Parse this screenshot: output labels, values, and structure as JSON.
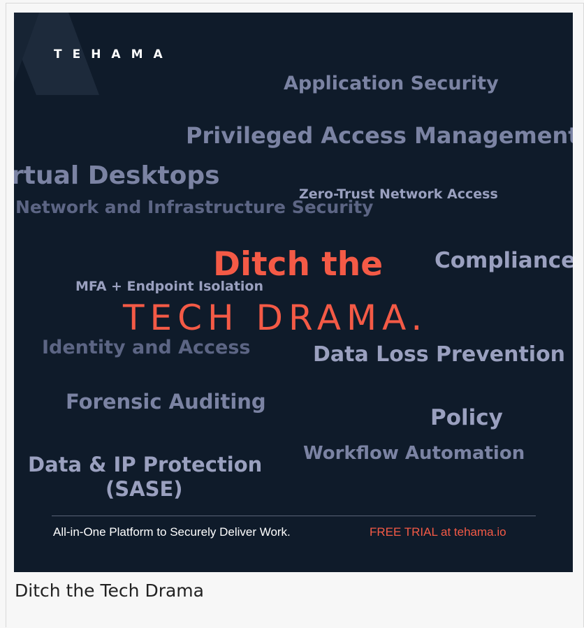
{
  "brand": {
    "logo": "TEHAMA"
  },
  "keywords": {
    "application_security": "Application Security",
    "privileged_access": "Privileged Access Management",
    "virtual_desktops": "rtual Desktops",
    "zero_trust": "Zero-Trust Network Access",
    "network_infra": "Network and Infrastructure Security",
    "compliance": "Compliance",
    "mfa": "MFA + Endpoint Isolation",
    "identity_access": "Identity and Access",
    "data_loss": "Data Loss Prevention",
    "forensic": "Forensic Auditing",
    "policy": "Policy",
    "workflow": "Workflow Automation",
    "data_ip_line1": "Data & IP Protection",
    "data_ip_line2": "(SASE)"
  },
  "headline": {
    "line1": "Ditch the",
    "line2": "TECH DRAMA."
  },
  "footer": {
    "tagline": "All-in-One Platform to Securely Deliver Work.",
    "cta": "FREE TRIAL at tehama.io"
  },
  "caption": "Ditch the Tech Drama",
  "colors": {
    "background": "#0f1b2a",
    "accent": "#f45a46",
    "keyword": "#6c7594"
  }
}
